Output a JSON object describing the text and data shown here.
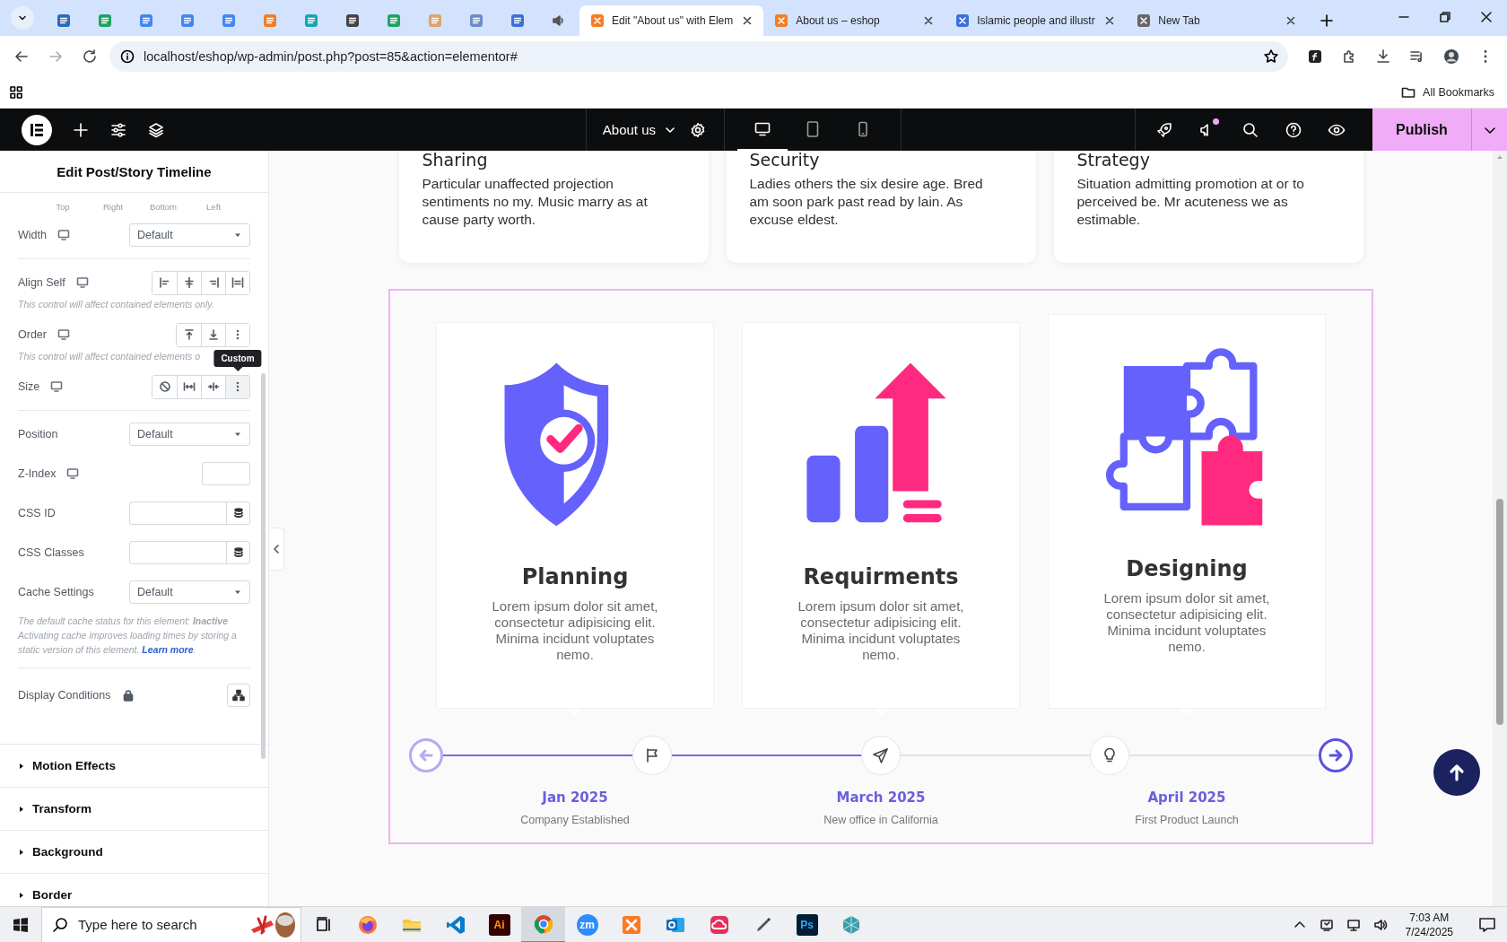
{
  "browser": {
    "tabs": [
      {
        "kind": "pinned",
        "color": "#2b6bb8",
        "selected": false
      },
      {
        "kind": "pinned",
        "color": "#1fa463",
        "selected": false
      },
      {
        "kind": "pinned",
        "color": "#4285f4",
        "selected": false
      },
      {
        "kind": "pinned",
        "color": "#4285f4",
        "selected": false
      },
      {
        "kind": "pinned",
        "color": "#4285f4",
        "selected": false
      },
      {
        "kind": "pinned",
        "color": "#f57c22",
        "selected": false
      },
      {
        "kind": "pinned",
        "color": "#18a6b5",
        "selected": false
      },
      {
        "kind": "pinned",
        "color": "#444444",
        "selected": false
      },
      {
        "kind": "pinned",
        "color": "#1fa463",
        "selected": false
      },
      {
        "kind": "pinned",
        "color": "#e0a36a",
        "selected": false
      },
      {
        "kind": "pinned",
        "color": "#6b8dc9",
        "selected": false
      },
      {
        "kind": "pinned",
        "color": "#3b6fd9",
        "selected": false
      },
      {
        "kind": "audio",
        "color": "#555555",
        "selected": false
      },
      {
        "kind": "page",
        "color": "#f57c22",
        "title": "Edit \"About us\" with Elem",
        "selected": true
      },
      {
        "kind": "page",
        "color": "#f57c22",
        "title": "About us – eshop",
        "selected": false
      },
      {
        "kind": "page",
        "color": "#3b6fd9",
        "title": "Islamic people and illustr",
        "selected": false
      },
      {
        "kind": "page",
        "color": "#666666",
        "title": "New Tab",
        "selected": false
      }
    ],
    "address": "localhost/eshop/wp-admin/post.php?post=85&action=elementor#",
    "bookmarks": "All Bookmarks"
  },
  "editor_bar": {
    "page": "About us",
    "devices": [
      {
        "kind": "desktop",
        "selected": true
      },
      {
        "kind": "tablet",
        "selected": false
      },
      {
        "kind": "mobile",
        "selected": false
      }
    ],
    "publish": "Publish"
  },
  "panel": {
    "title": "Edit Post/Story Timeline",
    "controls": [
      {
        "kind": "dimensions",
        "labels": [
          "Top",
          "Right",
          "Bottom",
          "Left"
        ]
      },
      {
        "kind": "select",
        "label": "Width",
        "responsive": true,
        "value": "Default"
      },
      {
        "kind": "divider"
      },
      {
        "kind": "buttons",
        "label": "Align Self",
        "responsive": true,
        "buttons": [
          {
            "kind": "start",
            "selected": false
          },
          {
            "kind": "center",
            "selected": false
          },
          {
            "kind": "end",
            "selected": false
          },
          {
            "kind": "stretch",
            "selected": false
          }
        ]
      },
      {
        "kind": "note",
        "text": "This control will affect contained elements only."
      },
      {
        "kind": "buttons",
        "label": "Order",
        "responsive": true,
        "buttons": [
          {
            "kind": "first",
            "selected": false
          },
          {
            "kind": "last",
            "selected": false
          },
          {
            "kind": "more",
            "selected": false
          }
        ]
      },
      {
        "kind": "note",
        "text": "This control will affect contained elements o"
      },
      {
        "kind": "buttons",
        "label": "Size",
        "responsive": true,
        "buttons": [
          {
            "kind": "none",
            "selected": false
          },
          {
            "kind": "grow",
            "selected": false
          },
          {
            "kind": "shrink",
            "selected": false
          },
          {
            "kind": "more",
            "selected": true,
            "tooltip": "Custom"
          }
        ]
      },
      {
        "kind": "divider"
      },
      {
        "kind": "select",
        "label": "Position",
        "responsive": false,
        "value": "Default"
      },
      {
        "kind": "number",
        "label": "Z-Index",
        "responsive": true
      },
      {
        "kind": "text",
        "label": "CSS ID"
      },
      {
        "kind": "text",
        "label": "CSS Classes"
      },
      {
        "kind": "select",
        "label": "Cache Settings",
        "responsive": false,
        "value": "Default"
      },
      {
        "kind": "cache-note",
        "text": "The default cache status for this element: **Inactive** Activating cache improves loading times by storing a static version of this element.",
        "link": "Learn more",
        "after": "."
      },
      {
        "kind": "divider"
      },
      {
        "kind": "conditions",
        "label": "Display Conditions",
        "locked": true
      }
    ],
    "sections": [
      {
        "title": "Motion Effects",
        "expanded": false
      },
      {
        "title": "Transform",
        "expanded": false
      },
      {
        "title": "Background",
        "expanded": false
      },
      {
        "title": "Border",
        "expanded": false
      }
    ]
  },
  "features": [
    {
      "title": "Sharing",
      "text": "Particular unaffected projection sentiments no my. Music marry as at cause party worth."
    },
    {
      "title": "Security",
      "text": "Ladies others the six desire age. Bred am soon park past read by lain. As excuse eldest."
    },
    {
      "title": "Strategy",
      "text": "Situation admitting promotion at or to perceived be. Mr acuteness we as estimable."
    }
  ],
  "timeline": {
    "prev_disabled": true,
    "next_disabled": false,
    "steps": [
      {
        "kind": "shield",
        "title": "Planning",
        "text": "Lorem ipsum dolor sit amet, consectetur adipisicing elit. Minima incidunt voluptates nemo.",
        "date": "Jan 2025",
        "caption": "Company Established",
        "reached": true
      },
      {
        "kind": "growth",
        "title": "Requirments",
        "text": "Lorem ipsum dolor sit amet, consectetur adipisicing elit. Minima incidunt voluptates nemo.",
        "date": "March 2025",
        "caption": "New office in California",
        "reached": true
      },
      {
        "kind": "puzzle",
        "title": "Designing",
        "text": "Lorem ipsum dolor sit amet, consectetur adipisicing elit. Minima incidunt voluptates nemo.",
        "date": "April 2025",
        "caption": "First Product Launch",
        "reached": false
      }
    ]
  },
  "taskbar": {
    "search": {
      "placeholder": "Type here to search"
    },
    "apps": [
      {
        "kind": "firefox",
        "selected": false
      },
      {
        "kind": "folder",
        "selected": false
      },
      {
        "kind": "vscode",
        "selected": false
      },
      {
        "kind": "illustrator",
        "glyph": "Ai",
        "selected": false
      },
      {
        "kind": "chrome",
        "selected": true
      },
      {
        "kind": "zoom",
        "glyph": "zm",
        "selected": false
      },
      {
        "kind": "xampp",
        "selected": false
      },
      {
        "kind": "outlook",
        "selected": false
      },
      {
        "kind": "cloud",
        "selected": false
      },
      {
        "kind": "pen",
        "selected": false
      },
      {
        "kind": "photoshop",
        "glyph": "Ps",
        "selected": false
      },
      {
        "kind": "gem",
        "selected": false
      }
    ],
    "time": "7:03 AM",
    "date": "7/24/2025"
  }
}
